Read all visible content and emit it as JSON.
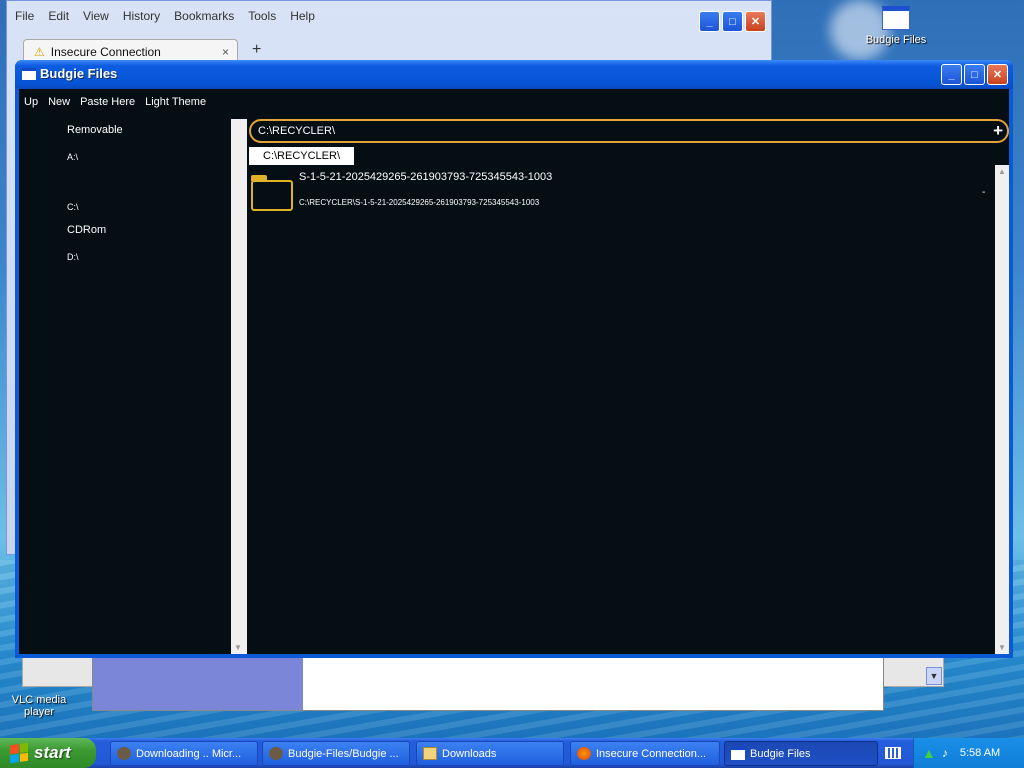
{
  "desktop": {
    "icons": [
      {
        "label": "Budgie Files"
      },
      {
        "label": "VLC media player"
      }
    ]
  },
  "firefox": {
    "menu": [
      "File",
      "Edit",
      "View",
      "History",
      "Bookmarks",
      "Tools",
      "Help"
    ],
    "tab_title": "Insecure Connection",
    "tab_close": "×",
    "new_tab": "+"
  },
  "budgie": {
    "title": "Budgie Files",
    "menu": [
      "Up",
      "New",
      "Paste Here",
      "Light Theme"
    ],
    "sidebar": {
      "groups": [
        {
          "label": "Removable",
          "drives": [
            "A:\\"
          ]
        },
        {
          "label": "",
          "drives": [
            "C:\\"
          ]
        },
        {
          "label": "CDRom",
          "drives": [
            "D:\\"
          ]
        }
      ]
    },
    "path_value": "C:\\RECYCLER\\",
    "path_button": "+",
    "breadcrumb": "C:\\RECYCLER\\",
    "items": [
      {
        "name": "S-1-5-21-2025429265-261903793-725345543-1003",
        "path": "C:\\RECYCLER\\S-1-5-21-2025429265-261903793-725345543-1003",
        "icon": "folder-icon"
      }
    ],
    "side_marker": "-"
  },
  "taskbar": {
    "start_label": "start",
    "items": [
      {
        "label": "Downloading .. Micr...",
        "icon": "app-icon"
      },
      {
        "label": "Budgie-Files/Budgie ...",
        "icon": "app-icon"
      },
      {
        "label": "Downloads",
        "icon": "folder-icon"
      },
      {
        "label": "Insecure Connection...",
        "icon": "firefox-icon"
      },
      {
        "label": "Budgie Files",
        "icon": "window-icon",
        "active": true
      }
    ],
    "clock": "5:58 AM"
  }
}
